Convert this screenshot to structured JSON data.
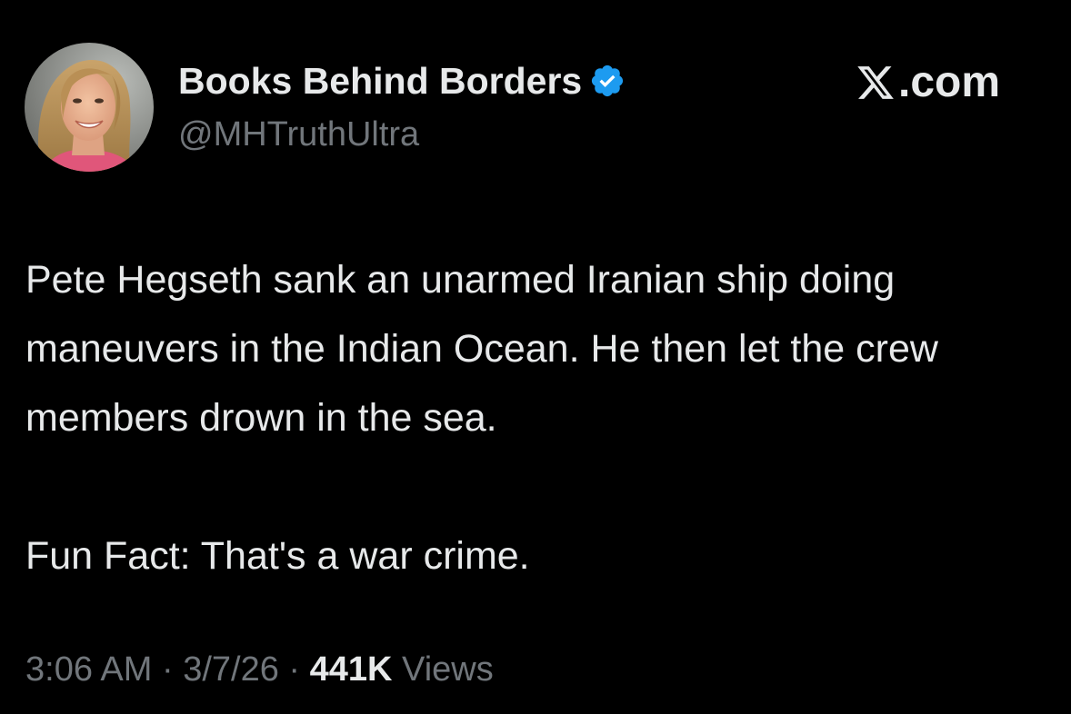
{
  "author": {
    "display_name": "Books Behind Borders",
    "handle": "@MHTruthUltra",
    "verified": true,
    "avatar_icon": "profile-photo"
  },
  "brand": {
    "icon": "x-logo-icon",
    "text": ".com"
  },
  "tweet": {
    "paragraphs": [
      "Pete Hegseth sank an unarmed Iranian ship doing maneuvers in the Indian Ocean. He then let the crew members drown in the sea.",
      "Fun Fact: That's a war crime."
    ]
  },
  "meta": {
    "time": "3:06 AM",
    "date": "3/7/26",
    "separator": "·",
    "views_count": "441K",
    "views_label": "Views"
  },
  "colors": {
    "background": "#000000",
    "primary_text": "#e7e9ea",
    "secondary_text": "#71767b",
    "verified_badge": "#1d9bf0"
  }
}
